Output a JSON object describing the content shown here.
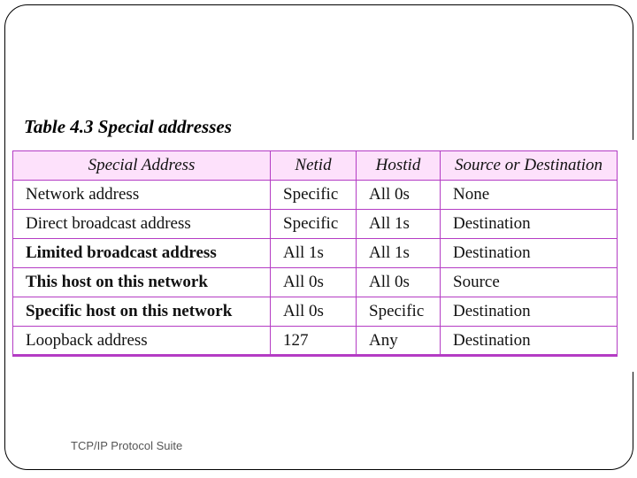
{
  "slide": {
    "title": "Table 4.3  Special addresses",
    "footer": "TCP/IP Protocol Suite"
  },
  "table": {
    "headers": [
      "Special Address",
      "Netid",
      "Hostid",
      "Source or Destination"
    ],
    "rows": [
      {
        "special_address": "Network address",
        "netid": "Specific",
        "hostid": "All 0s",
        "source_or_destination": "None",
        "bold": false
      },
      {
        "special_address": "Direct broadcast address",
        "netid": "Specific",
        "hostid": "All 1s",
        "source_or_destination": "Destination",
        "bold": false
      },
      {
        "special_address": "Limited broadcast address",
        "netid": "All 1s",
        "hostid": "All 1s",
        "source_or_destination": "Destination",
        "bold": true
      },
      {
        "special_address": "This host on this network",
        "netid": "All 0s",
        "hostid": "All 0s",
        "source_or_destination": "Source",
        "bold": true
      },
      {
        "special_address": "Specific host on this network",
        "netid": "All 0s",
        "hostid": "Specific",
        "source_or_destination": "Destination",
        "bold": true
      },
      {
        "special_address": "Loopback address",
        "netid": "127",
        "hostid": "Any",
        "source_or_destination": "Destination",
        "bold": false
      }
    ]
  },
  "colors": {
    "header_background": "#fde1fb",
    "border": "#b43cc4"
  }
}
